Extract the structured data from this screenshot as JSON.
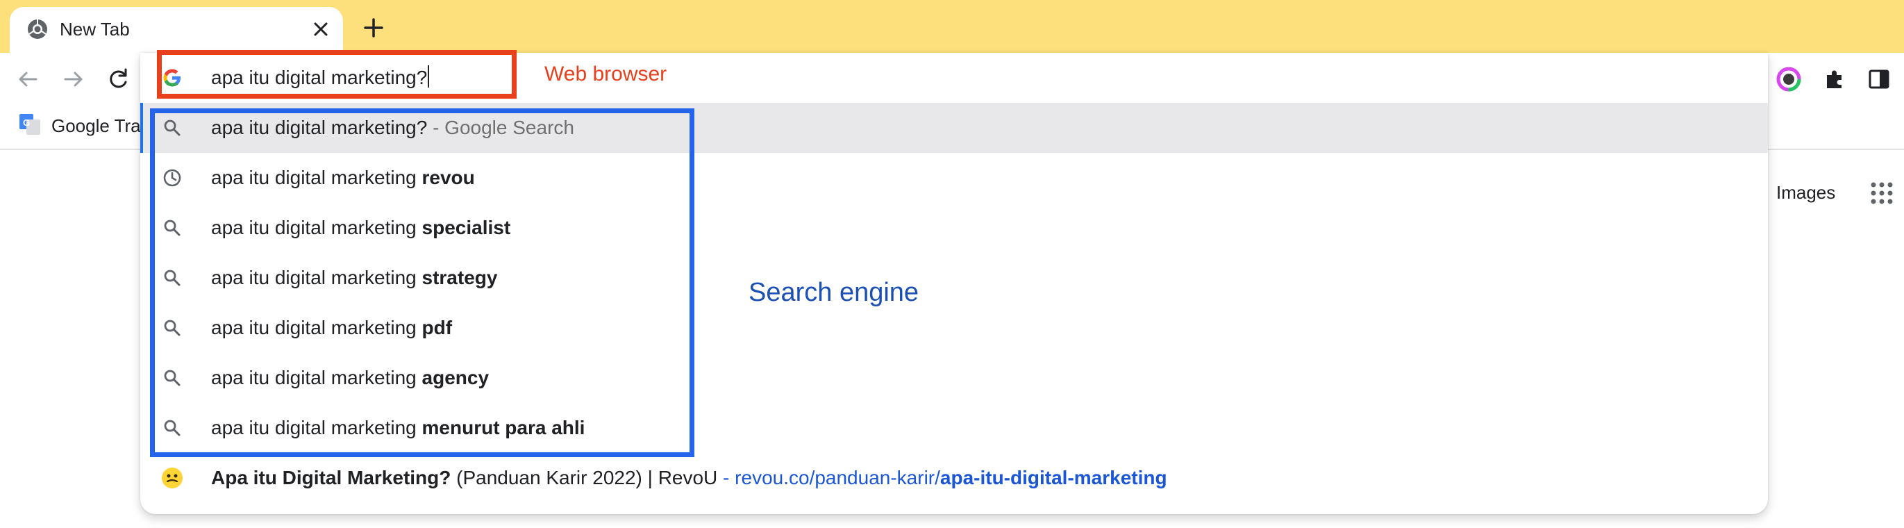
{
  "tab": {
    "title": "New Tab"
  },
  "bookmarks": {
    "items": [
      {
        "label": "Google Tran"
      }
    ]
  },
  "page": {
    "images_link": "Images"
  },
  "omnibox": {
    "value": "apa itu digital marketing?"
  },
  "suggestions": [
    {
      "icon": "search-icon",
      "prefix": "apa itu digital marketing?",
      "bold": "",
      "suffix": " - Google Search",
      "selected": true
    },
    {
      "icon": "history-icon",
      "prefix": "apa itu digital marketing ",
      "bold": "revou",
      "suffix": ""
    },
    {
      "icon": "search-icon",
      "prefix": "apa itu digital marketing ",
      "bold": "specialist",
      "suffix": ""
    },
    {
      "icon": "search-icon",
      "prefix": "apa itu digital marketing ",
      "bold": "strategy",
      "suffix": ""
    },
    {
      "icon": "search-icon",
      "prefix": "apa itu digital marketing ",
      "bold": "pdf",
      "suffix": ""
    },
    {
      "icon": "search-icon",
      "prefix": "apa itu digital marketing ",
      "bold": "agency",
      "suffix": ""
    },
    {
      "icon": "search-icon",
      "prefix": "apa itu digital marketing ",
      "bold": "menurut para ahli",
      "suffix": ""
    }
  ],
  "site_suggestion": {
    "icon": "revou-favicon",
    "title_bold": "Apa itu Digital Marketing?",
    "title_rest": " (Panduan Karir 2022) | RevoU",
    "separator": " - ",
    "url_plain": "revou.co/panduan-karir/",
    "url_bold": "apa-itu-digital-marketing"
  },
  "annotations": {
    "web_browser": "Web browser",
    "search_engine": "Search engine"
  },
  "colors": {
    "tabstrip": "#fde07b",
    "annotation_red": "#e8401c",
    "annotation_blue": "#2563eb",
    "url_blue": "#1a56d6"
  }
}
